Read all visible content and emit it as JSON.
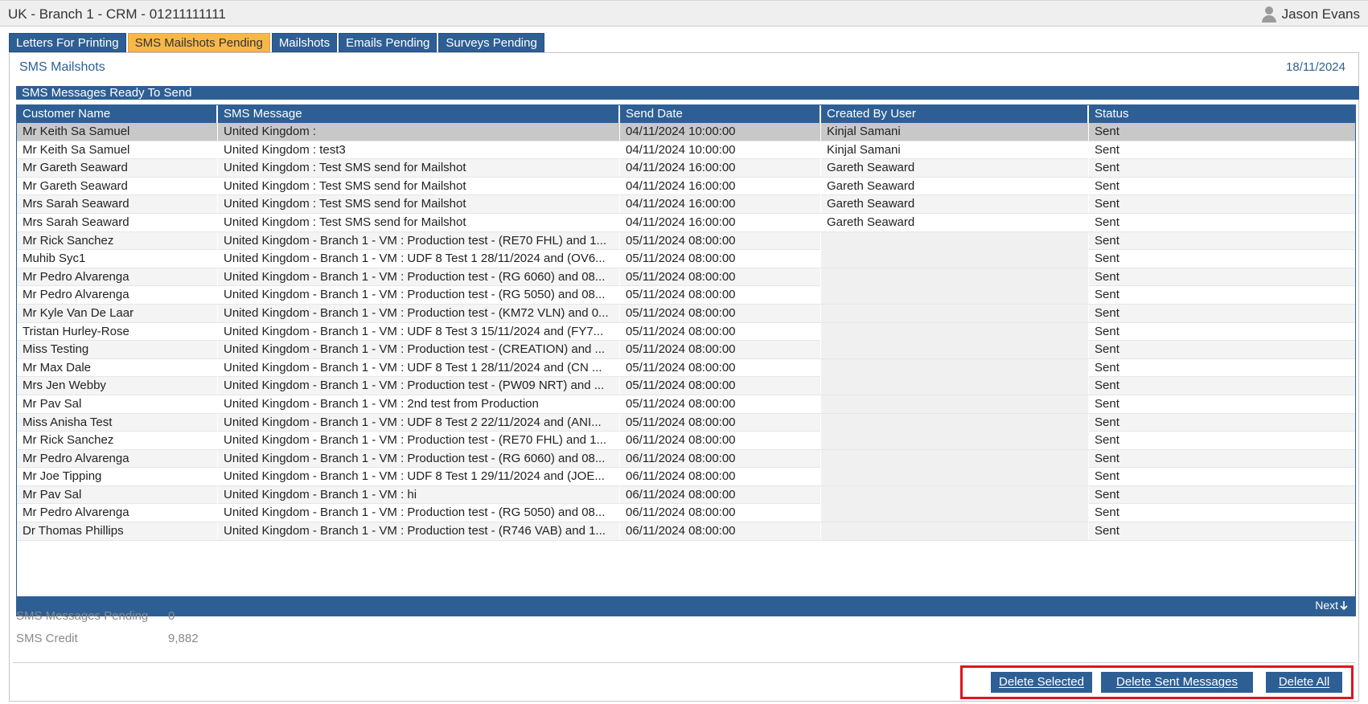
{
  "app": {
    "title": "UK - Branch 1 - CRM - 01211111111",
    "user_name": "Jason Evans",
    "user_icon": "user-icon"
  },
  "tabs": [
    {
      "label": "Letters For Printing",
      "active": false
    },
    {
      "label": "SMS Mailshots Pending",
      "active": true
    },
    {
      "label": "Mailshots",
      "active": false
    },
    {
      "label": "Emails Pending",
      "active": false
    },
    {
      "label": "Surveys Pending",
      "active": false
    }
  ],
  "panel": {
    "title": "SMS Mailshots",
    "date": "18/11/2024"
  },
  "grid": {
    "caption": "SMS Messages Ready To Send",
    "columns": [
      "Customer Name",
      "SMS Message",
      "Send Date",
      "Created By User",
      "Status"
    ],
    "rows": [
      [
        "Mr Keith Sa Samuel",
        "United Kingdom :",
        "04/11/2024 10:00:00",
        "Kinjal Samani",
        "Sent"
      ],
      [
        "Mr Keith Sa Samuel",
        "United Kingdom : test3",
        "04/11/2024 10:00:00",
        "Kinjal Samani",
        "Sent"
      ],
      [
        "Mr Gareth Seaward",
        "United Kingdom : Test SMS send for Mailshot",
        "04/11/2024 16:00:00",
        "Gareth Seaward",
        "Sent"
      ],
      [
        "Mr Gareth Seaward",
        "United Kingdom : Test SMS send for Mailshot",
        "04/11/2024 16:00:00",
        "Gareth Seaward",
        "Sent"
      ],
      [
        "Mrs Sarah Seaward",
        "United Kingdom : Test SMS send for Mailshot",
        "04/11/2024 16:00:00",
        "Gareth Seaward",
        "Sent"
      ],
      [
        "Mrs Sarah Seaward",
        "United Kingdom : Test SMS send for Mailshot",
        "04/11/2024 16:00:00",
        "Gareth Seaward",
        "Sent"
      ],
      [
        "Mr Rick Sanchez",
        "United Kingdom - Branch 1 - VM : Production test - (RE70 FHL) and 1...",
        "05/11/2024 08:00:00",
        "",
        "Sent"
      ],
      [
        "Muhib Syc1",
        "United Kingdom - Branch 1 - VM : UDF 8 Test 1 28/11/2024 and (OV6...",
        "05/11/2024 08:00:00",
        "",
        "Sent"
      ],
      [
        "Mr Pedro Alvarenga",
        "United Kingdom - Branch 1 - VM : Production test - (RG 6060) and 08...",
        "05/11/2024 08:00:00",
        "",
        "Sent"
      ],
      [
        "Mr Pedro Alvarenga",
        "United Kingdom - Branch 1 - VM : Production test - (RG 5050) and 08...",
        "05/11/2024 08:00:00",
        "",
        "Sent"
      ],
      [
        "Mr Kyle Van De Laar",
        "United Kingdom - Branch 1 - VM : Production test - (KM72 VLN) and 0...",
        "05/11/2024 08:00:00",
        "",
        "Sent"
      ],
      [
        "Tristan Hurley-Rose",
        "United Kingdom - Branch 1 - VM : UDF 8 Test 3 15/11/2024 and (FY7...",
        "05/11/2024 08:00:00",
        "",
        "Sent"
      ],
      [
        "Miss Testing",
        "United Kingdom - Branch 1 - VM : Production test - (CREATION) and ...",
        "05/11/2024 08:00:00",
        "",
        "Sent"
      ],
      [
        "Mr Max Dale",
        "United Kingdom - Branch 1 - VM : UDF 8 Test 1 28/11/2024 and (CN ...",
        "05/11/2024 08:00:00",
        "",
        "Sent"
      ],
      [
        "Mrs Jen Webby",
        "United Kingdom - Branch 1 - VM : Production test - (PW09 NRT) and ...",
        "05/11/2024 08:00:00",
        "",
        "Sent"
      ],
      [
        "Mr Pav Sal",
        "United Kingdom - Branch 1 - VM : 2nd test from Production",
        "05/11/2024 08:00:00",
        "",
        "Sent"
      ],
      [
        "Miss Anisha Test",
        "United Kingdom - Branch 1 - VM : UDF 8 Test 2 22/11/2024 and (ANI...",
        "05/11/2024 08:00:00",
        "",
        "Sent"
      ],
      [
        "Mr Rick Sanchez",
        "United Kingdom - Branch 1 - VM : Production test - (RE70 FHL) and 1...",
        "06/11/2024 08:00:00",
        "",
        "Sent"
      ],
      [
        "Mr Pedro Alvarenga",
        "United Kingdom - Branch 1 - VM : Production test - (RG 6060) and 08...",
        "06/11/2024 08:00:00",
        "",
        "Sent"
      ],
      [
        "Mr Joe Tipping",
        "United Kingdom - Branch 1 - VM : UDF 8 Test 1 29/11/2024 and (JOE...",
        "06/11/2024 08:00:00",
        "",
        "Sent"
      ],
      [
        "Mr Pav Sal",
        "United Kingdom - Branch 1 - VM : hi",
        "06/11/2024 08:00:00",
        "",
        "Sent"
      ],
      [
        "Mr Pedro Alvarenga",
        "United Kingdom - Branch 1 - VM : Production test - (RG 5050) and 08...",
        "06/11/2024 08:00:00",
        "",
        "Sent"
      ],
      [
        "Dr Thomas Phillips",
        "United Kingdom - Branch 1 - VM : Production test - (R746 VAB) and 1...",
        "06/11/2024 08:00:00",
        "",
        "Sent"
      ]
    ],
    "selected_row": 0,
    "next_label": "Next",
    "next_icon": "arrow-down-icon"
  },
  "stats": {
    "pending_label": "SMS Messages Pending",
    "pending_value": "0",
    "credit_label": "SMS Credit",
    "credit_value": "9,882"
  },
  "actions": {
    "delete_selected": "Delete Selected",
    "delete_sent": "Delete Sent Messages",
    "delete_all": "Delete All"
  },
  "colors": {
    "header_blue": "#2e5f94",
    "active_tab": "#f7b84a",
    "highlight_border": "#e1131f"
  }
}
